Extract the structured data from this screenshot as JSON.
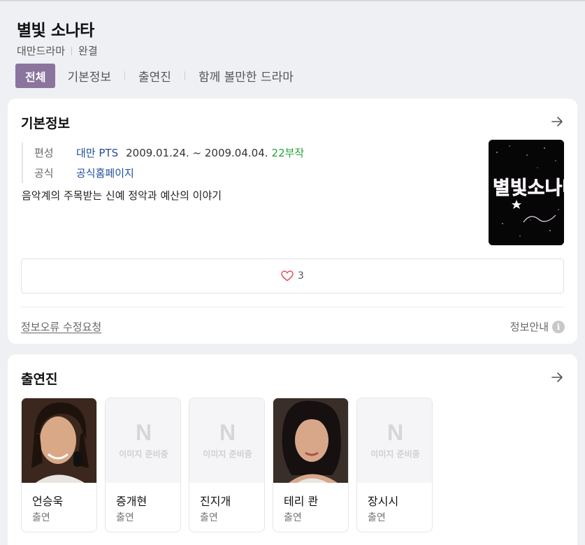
{
  "header": {
    "title": "별빛 소나타",
    "meta": [
      "대만드라마",
      "완결"
    ],
    "tabs": [
      {
        "label": "전체",
        "active": true
      },
      {
        "label": "기본정보",
        "active": false
      },
      {
        "label": "출연진",
        "active": false
      },
      {
        "label": "함께 볼만한 드라마",
        "active": false
      }
    ]
  },
  "basic_info": {
    "section_title": "기본정보",
    "rows": {
      "broadcast_label": "편성",
      "channel": "대만 PTS",
      "dates": "2009.01.24. ~ 2009.04.04.",
      "episodes": "22부작",
      "official_label": "공식",
      "official_link": "공식홈페이지"
    },
    "description": "음악계의 주목받는 신예 정악과 예산의 이야기",
    "likes": "3",
    "report_link": "정보오류 수정요청",
    "info_guide": "정보안내",
    "poster_text": "별빛소나타"
  },
  "cast": {
    "section_title": "출연진",
    "placeholder_mark": "N",
    "placeholder_text": "이미지 준비중",
    "members": [
      {
        "name": "언승욱",
        "role": "출연",
        "has_photo": true
      },
      {
        "name": "증개현",
        "role": "출연",
        "has_photo": false
      },
      {
        "name": "진지개",
        "role": "출연",
        "has_photo": false
      },
      {
        "name": "테리 콴",
        "role": "출연",
        "has_photo": true
      },
      {
        "name": "장시시",
        "role": "출연",
        "has_photo": false
      }
    ]
  },
  "colors": {
    "accent": "#8b749e",
    "link": "#1f4e9c",
    "episodes": "#25a33b",
    "background": "#eef0f4"
  }
}
